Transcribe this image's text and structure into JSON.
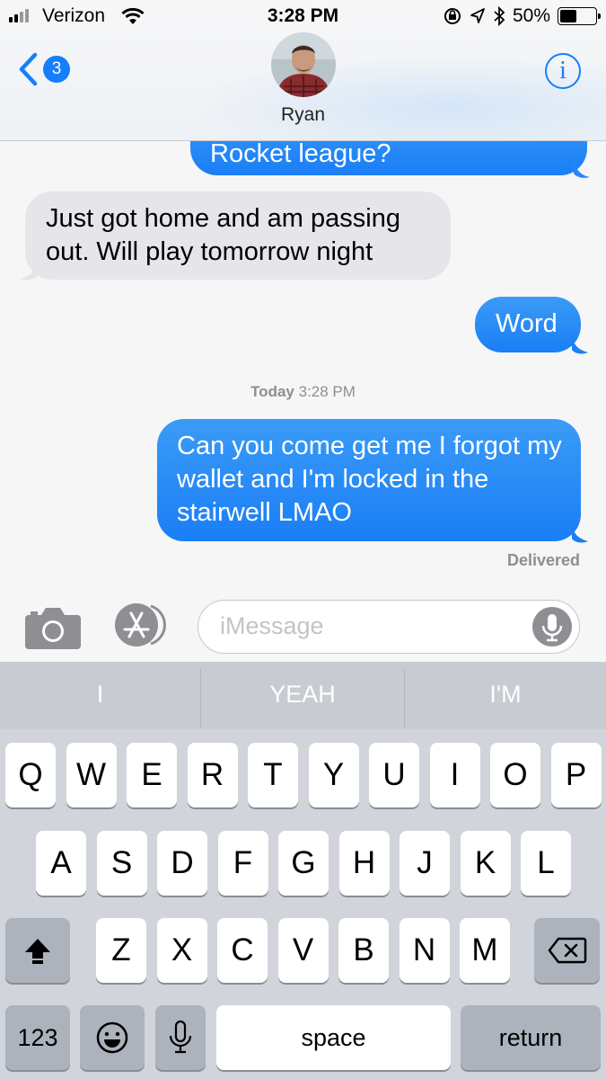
{
  "status_bar": {
    "carrier": "Verizon",
    "time": "3:28 PM",
    "battery": "50%",
    "battery_level": 0.5,
    "icons": [
      "signal-icon",
      "wifi-icon",
      "orientation-lock-icon",
      "location-icon",
      "bluetooth-icon",
      "battery-icon"
    ]
  },
  "header": {
    "back_count": "3",
    "contact_name": "Ryan",
    "info_label": "i"
  },
  "messages": [
    {
      "direction": "out",
      "text": "Rocket league?"
    },
    {
      "direction": "in",
      "text": "Just got home and am passing out. Will play tomorrow night"
    },
    {
      "direction": "out",
      "text": "Word"
    },
    {
      "direction": "out",
      "text": "Can you come get me I forgot my wallet and I'm locked in the stairwell LMAO"
    }
  ],
  "timestamp": {
    "day": "Today",
    "time": "3:28 PM"
  },
  "delivered_label": "Delivered",
  "input": {
    "placeholder": "iMessage"
  },
  "keyboard": {
    "suggestions": [
      "I",
      "YEAH",
      "I'M"
    ],
    "row1": [
      "Q",
      "W",
      "E",
      "R",
      "T",
      "Y",
      "U",
      "I",
      "O",
      "P"
    ],
    "row2": [
      "A",
      "S",
      "D",
      "F",
      "G",
      "H",
      "J",
      "K",
      "L"
    ],
    "row3": [
      "Z",
      "X",
      "C",
      "V",
      "B",
      "N",
      "M"
    ],
    "numbers_label": "123",
    "space_label": "space",
    "return_label": "return"
  },
  "colors": {
    "accent": "#147efb",
    "bubble_out": "#1a7ef6",
    "bubble_in": "#e5e5ea"
  }
}
